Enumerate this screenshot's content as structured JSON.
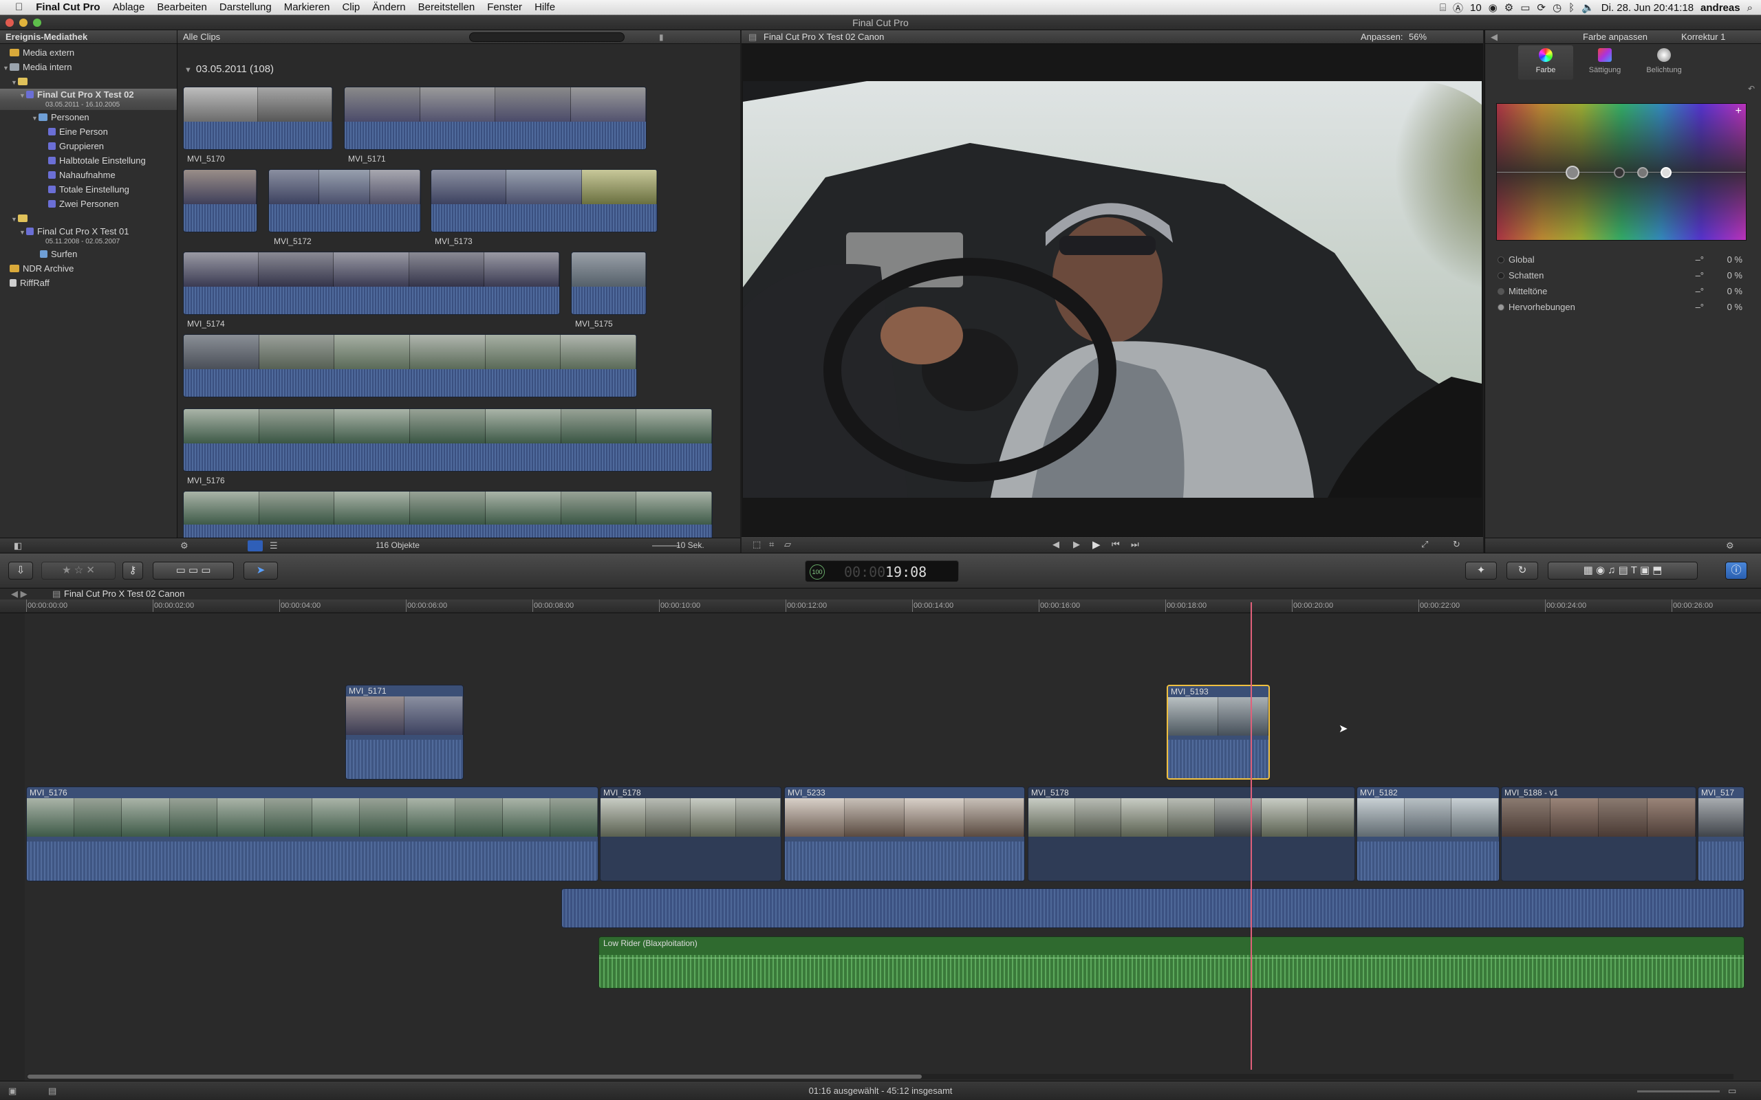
{
  "menubar": {
    "items": [
      "Final Cut Pro",
      "Ablage",
      "Bearbeiten",
      "Darstellung",
      "Markieren",
      "Clip",
      "Ändern",
      "Bereitstellen",
      "Fenster",
      "Hilfe"
    ],
    "status": {
      "badge": "10",
      "datetime": "Di. 28. Jun  20:41:18",
      "user": "andreas"
    }
  },
  "window": {
    "title": "Final Cut Pro"
  },
  "library": {
    "title": "Ereignis-Mediathek",
    "items": [
      {
        "label": "Media extern"
      },
      {
        "label": "Media intern"
      },
      {
        "label": ""
      },
      {
        "label": "Final Cut Pro X Test 02",
        "sub": "03.05.2011 - 16.10.2005"
      },
      {
        "label": "Personen"
      },
      {
        "label": "Eine Person"
      },
      {
        "label": "Gruppieren"
      },
      {
        "label": "Halbtotale Einstellung"
      },
      {
        "label": "Nahaufnahme"
      },
      {
        "label": "Totale Einstellung"
      },
      {
        "label": "Zwei Personen"
      },
      {
        "label": ""
      },
      {
        "label": "Final Cut Pro X Test 01",
        "sub": "05.11.2008 - 02.05.2007"
      },
      {
        "label": "Surfen"
      },
      {
        "label": "NDR Archive"
      },
      {
        "label": "RiffRaff"
      }
    ]
  },
  "browser": {
    "filter": "Alle Clips",
    "date_group": "03.05.2011  (108)",
    "clips": [
      "MVI_5170",
      "MVI_5171",
      "MVI_5172",
      "MVI_5173",
      "MVI_5174",
      "MVI_5175",
      "MVI_5176"
    ],
    "count": "116 Objekte",
    "duration": "10 Sek."
  },
  "viewer": {
    "title": "Final Cut Pro X Test 02 Canon",
    "fit_label": "Anpassen:",
    "fit_value": "56%"
  },
  "inspector": {
    "title": "Farbe anpassen",
    "correction": "Korrektur 1",
    "tabs": [
      "Farbe",
      "Sättigung",
      "Belichtung"
    ],
    "rows": [
      {
        "label": "Global",
        "v1": "–°",
        "v2": "0 %"
      },
      {
        "label": "Schatten",
        "v1": "–°",
        "v2": "0 %"
      },
      {
        "label": "Mitteltöne",
        "v1": "–°",
        "v2": "0 %"
      },
      {
        "label": "Hervorhebungen",
        "v1": "–°",
        "v2": "0 %"
      }
    ]
  },
  "toolbar": {
    "timecode": "19:08",
    "tc_prefix": "100"
  },
  "timeline": {
    "project": "Final Cut Pro X Test 02 Canon",
    "ruler": [
      "00:00:00:00",
      "00:00:02:00",
      "00:00:04:00",
      "00:00:06:00",
      "00:00:08:00",
      "00:00:10:00",
      "00:00:12:00",
      "00:00:14:00",
      "00:00:16:00",
      "00:00:18:00",
      "00:00:20:00",
      "00:00:22:00",
      "00:00:24:00",
      "00:00:26:00"
    ],
    "connected": [
      "MVI_5171",
      "MVI_5193"
    ],
    "primary": [
      "MVI_5176",
      "MVI_5178",
      "MVI_5233",
      "MVI_5178",
      "MVI_5182",
      "MVI_5188 - v1",
      "MVI_517"
    ],
    "music": "Low Rider (Blaxploitation)"
  },
  "status": {
    "text": "01:16 ausgewählt - 45:12 insgesamt"
  }
}
